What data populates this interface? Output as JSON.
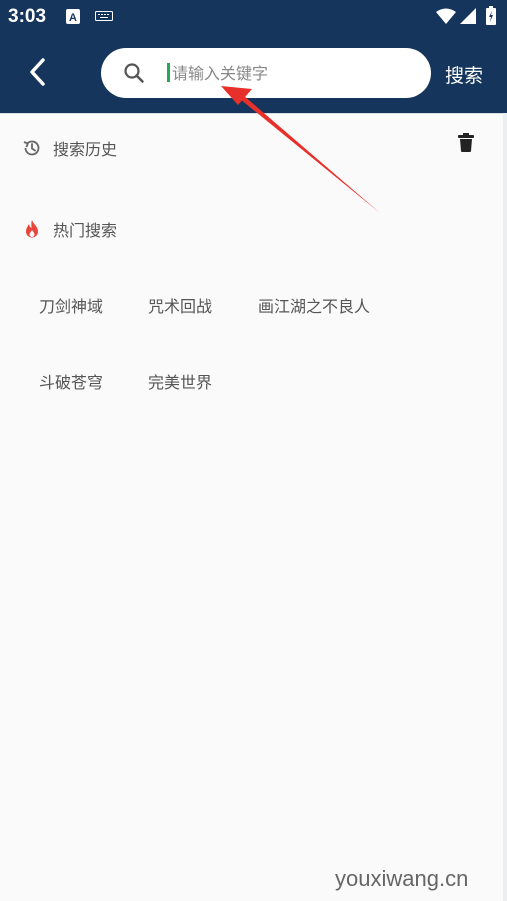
{
  "status_bar": {
    "time": "3:03",
    "icons": [
      "a-badge-icon",
      "keyboard-icon",
      "wifi-icon",
      "signal-icon",
      "battery-icon"
    ]
  },
  "header": {
    "search": {
      "placeholder": "请输入关键字",
      "value": ""
    },
    "search_button": "搜索"
  },
  "history": {
    "title": "搜索历史"
  },
  "hot": {
    "title": "热门搜索",
    "tags": [
      "刀剑神域",
      "咒术回战",
      "画江湖之不良人",
      "斗破苍穹",
      "完美世界"
    ]
  },
  "watermark": "youxiwang.cn",
  "colors": {
    "header_bg": "#15355c",
    "background": "#fafafa",
    "hot_icon": "#e8453c",
    "cursor": "#27a559",
    "annotation_arrow": "#e8302a"
  }
}
